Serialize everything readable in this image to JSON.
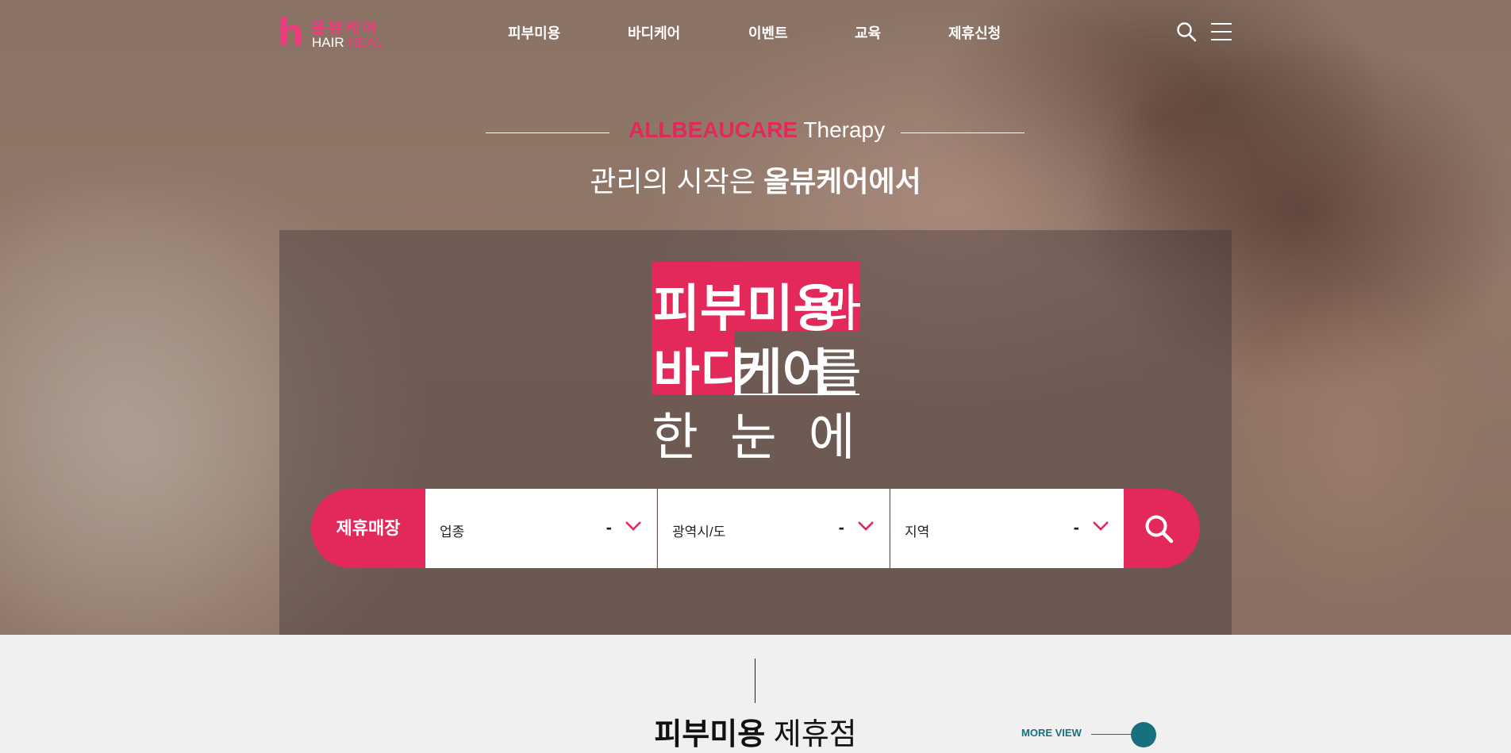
{
  "logo": {
    "h": "h",
    "korean": "올뷰케어",
    "english_1": "HAIR",
    "english_2": "HEAL"
  },
  "nav": {
    "items": [
      {
        "label": "피부미용"
      },
      {
        "label": "바디케어"
      },
      {
        "label": "이벤트"
      },
      {
        "label": "교육"
      },
      {
        "label": "제휴신청"
      }
    ]
  },
  "icons": {
    "search": "search-icon",
    "menu": "hamburger-menu-icon",
    "dropdown": "chevron-down-icon"
  },
  "hero": {
    "brand_pink": "ALLBEAUCARE",
    "brand_white": "Therapy",
    "subtitle_normal": "관리의 시작은",
    "subtitle_bold": "올뷰케어에서",
    "headline_1_bold": "피부미용",
    "headline_1_normal": "과",
    "headline_2_bold_a": "바디",
    "headline_2_bold_b": "케어",
    "headline_2_normal": "를",
    "headline_3": "한눈에"
  },
  "search": {
    "label": "제휴매장",
    "selects": [
      {
        "label": "업종",
        "value": "-"
      },
      {
        "label": "광역시/도",
        "value": "-"
      },
      {
        "label": "지역",
        "value": "-"
      }
    ]
  },
  "section": {
    "title_bold": "피부미용",
    "title_normal": "제휴점",
    "more_label": "MORE VIEW"
  },
  "colors": {
    "accent": "#e3285a",
    "logo_pink": "#ec3e7d",
    "teal": "#17707d",
    "background": "#f0f0f0"
  }
}
